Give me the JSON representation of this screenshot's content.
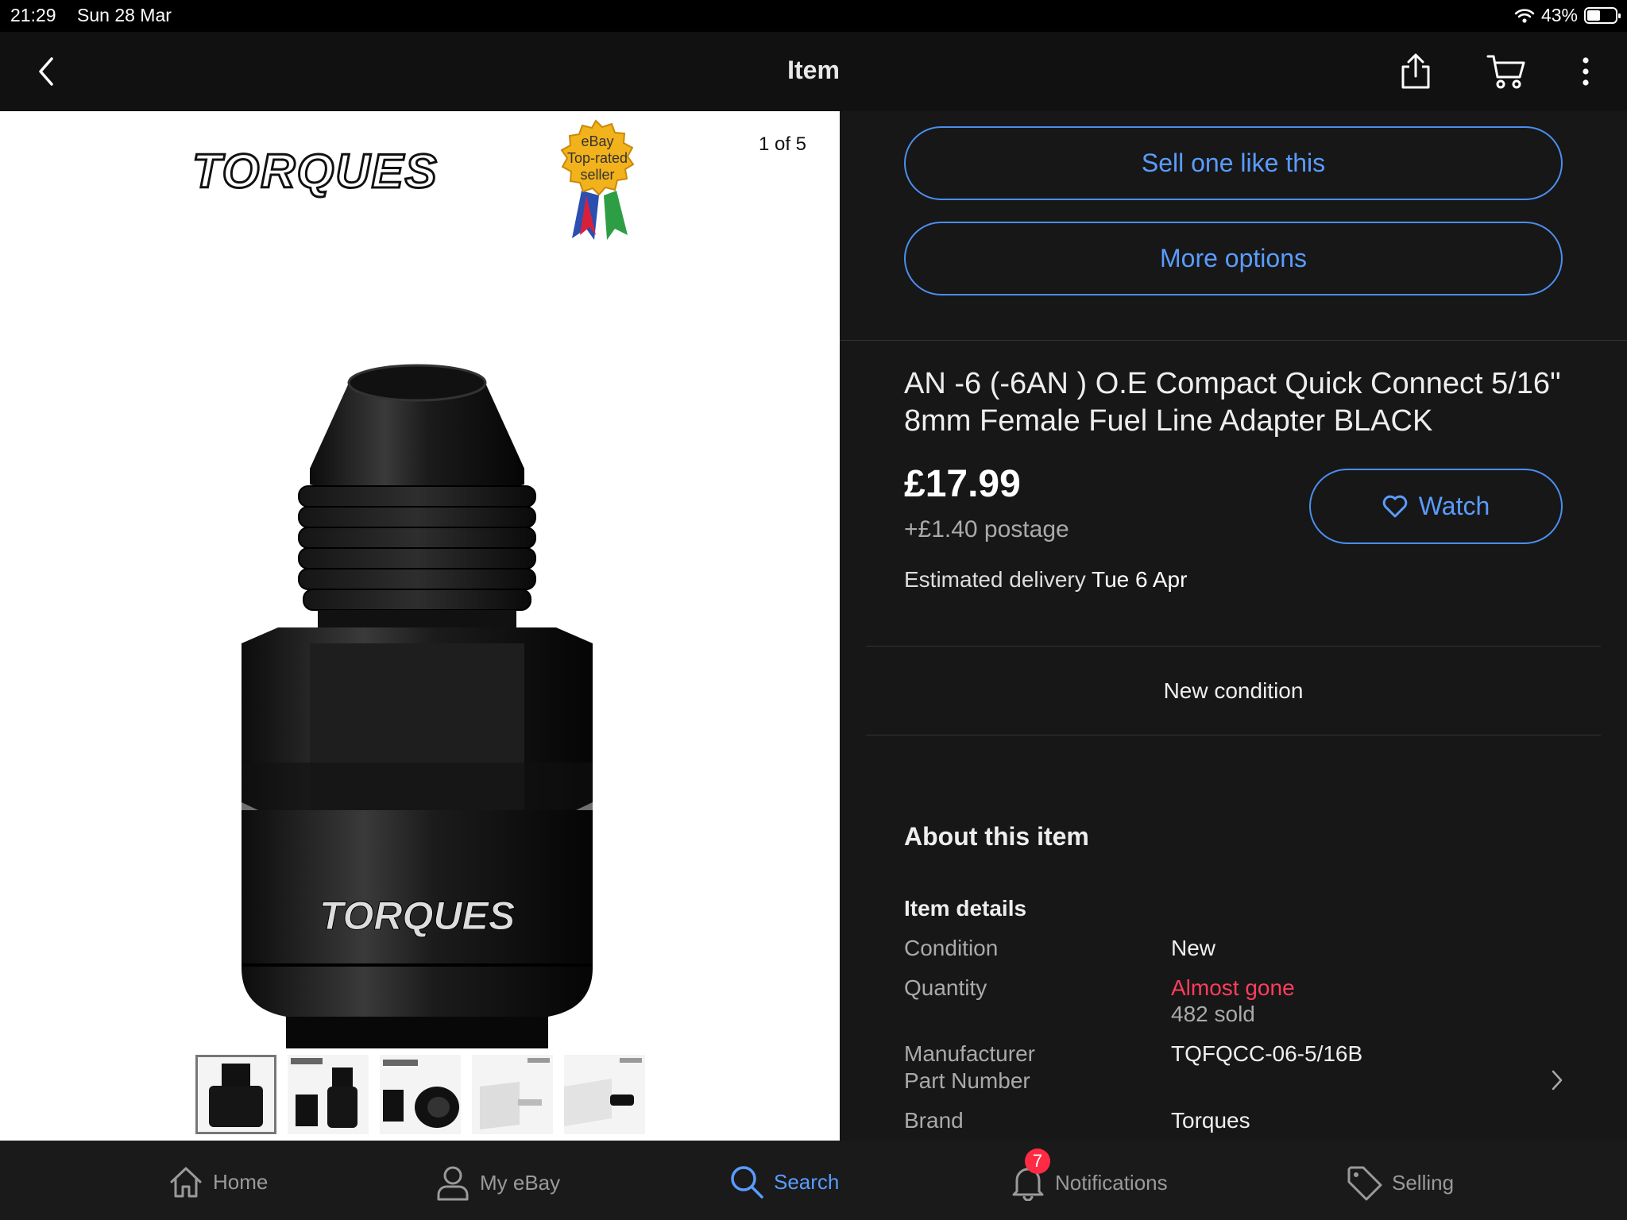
{
  "status_bar": {
    "time": "21:29",
    "date": "Sun 28 Mar",
    "battery": "43%"
  },
  "nav": {
    "title": "Item",
    "icons": [
      "back-chevron-icon",
      "share-icon",
      "cart-icon",
      "more-vertical-icon"
    ]
  },
  "gallery": {
    "counter": "1 of 5",
    "brand_logo": "TORQUES",
    "badge": {
      "line1": "eBay",
      "line2": "Top-rated",
      "line3": "seller"
    },
    "product_logo": "TORQUES",
    "thumbnail_count": 5
  },
  "actions": {
    "sell_label": "Sell one like this",
    "more_label": "More options"
  },
  "listing": {
    "title": "AN -6 (-6AN ) O.E Compact Quick Connect 5/16\" 8mm Female Fuel Line Adapter BLACK",
    "price": "£17.99",
    "postage": "+£1.40 postage",
    "delivery_label": "Estimated delivery",
    "delivery_date": "Tue 6 Apr",
    "watch_label": "Watch",
    "condition_line": "New condition"
  },
  "about": {
    "heading": "About this item",
    "details_heading": "Item details",
    "rows": [
      {
        "label": "Condition",
        "value": "New"
      },
      {
        "label": "Quantity",
        "value": "Almost gone",
        "sub": "482 sold"
      },
      {
        "label": "Manufacturer Part Number",
        "label_line1": "Manufacturer",
        "label_line2": "Part Number",
        "value": "TQFQCC-06-5/16B"
      },
      {
        "label": "Brand",
        "value": "Torques"
      }
    ]
  },
  "tabs": [
    {
      "label": "Home",
      "icon": "home-icon"
    },
    {
      "label": "My eBay",
      "icon": "person-icon"
    },
    {
      "label": "Search",
      "icon": "search-icon",
      "active": true
    },
    {
      "label": "Notifications",
      "icon": "bell-icon",
      "badge": "7"
    },
    {
      "label": "Selling",
      "icon": "tag-icon"
    }
  ],
  "colors": {
    "accent": "#5a9cff",
    "alert": "#ff3d5e",
    "panel": "#171717"
  }
}
